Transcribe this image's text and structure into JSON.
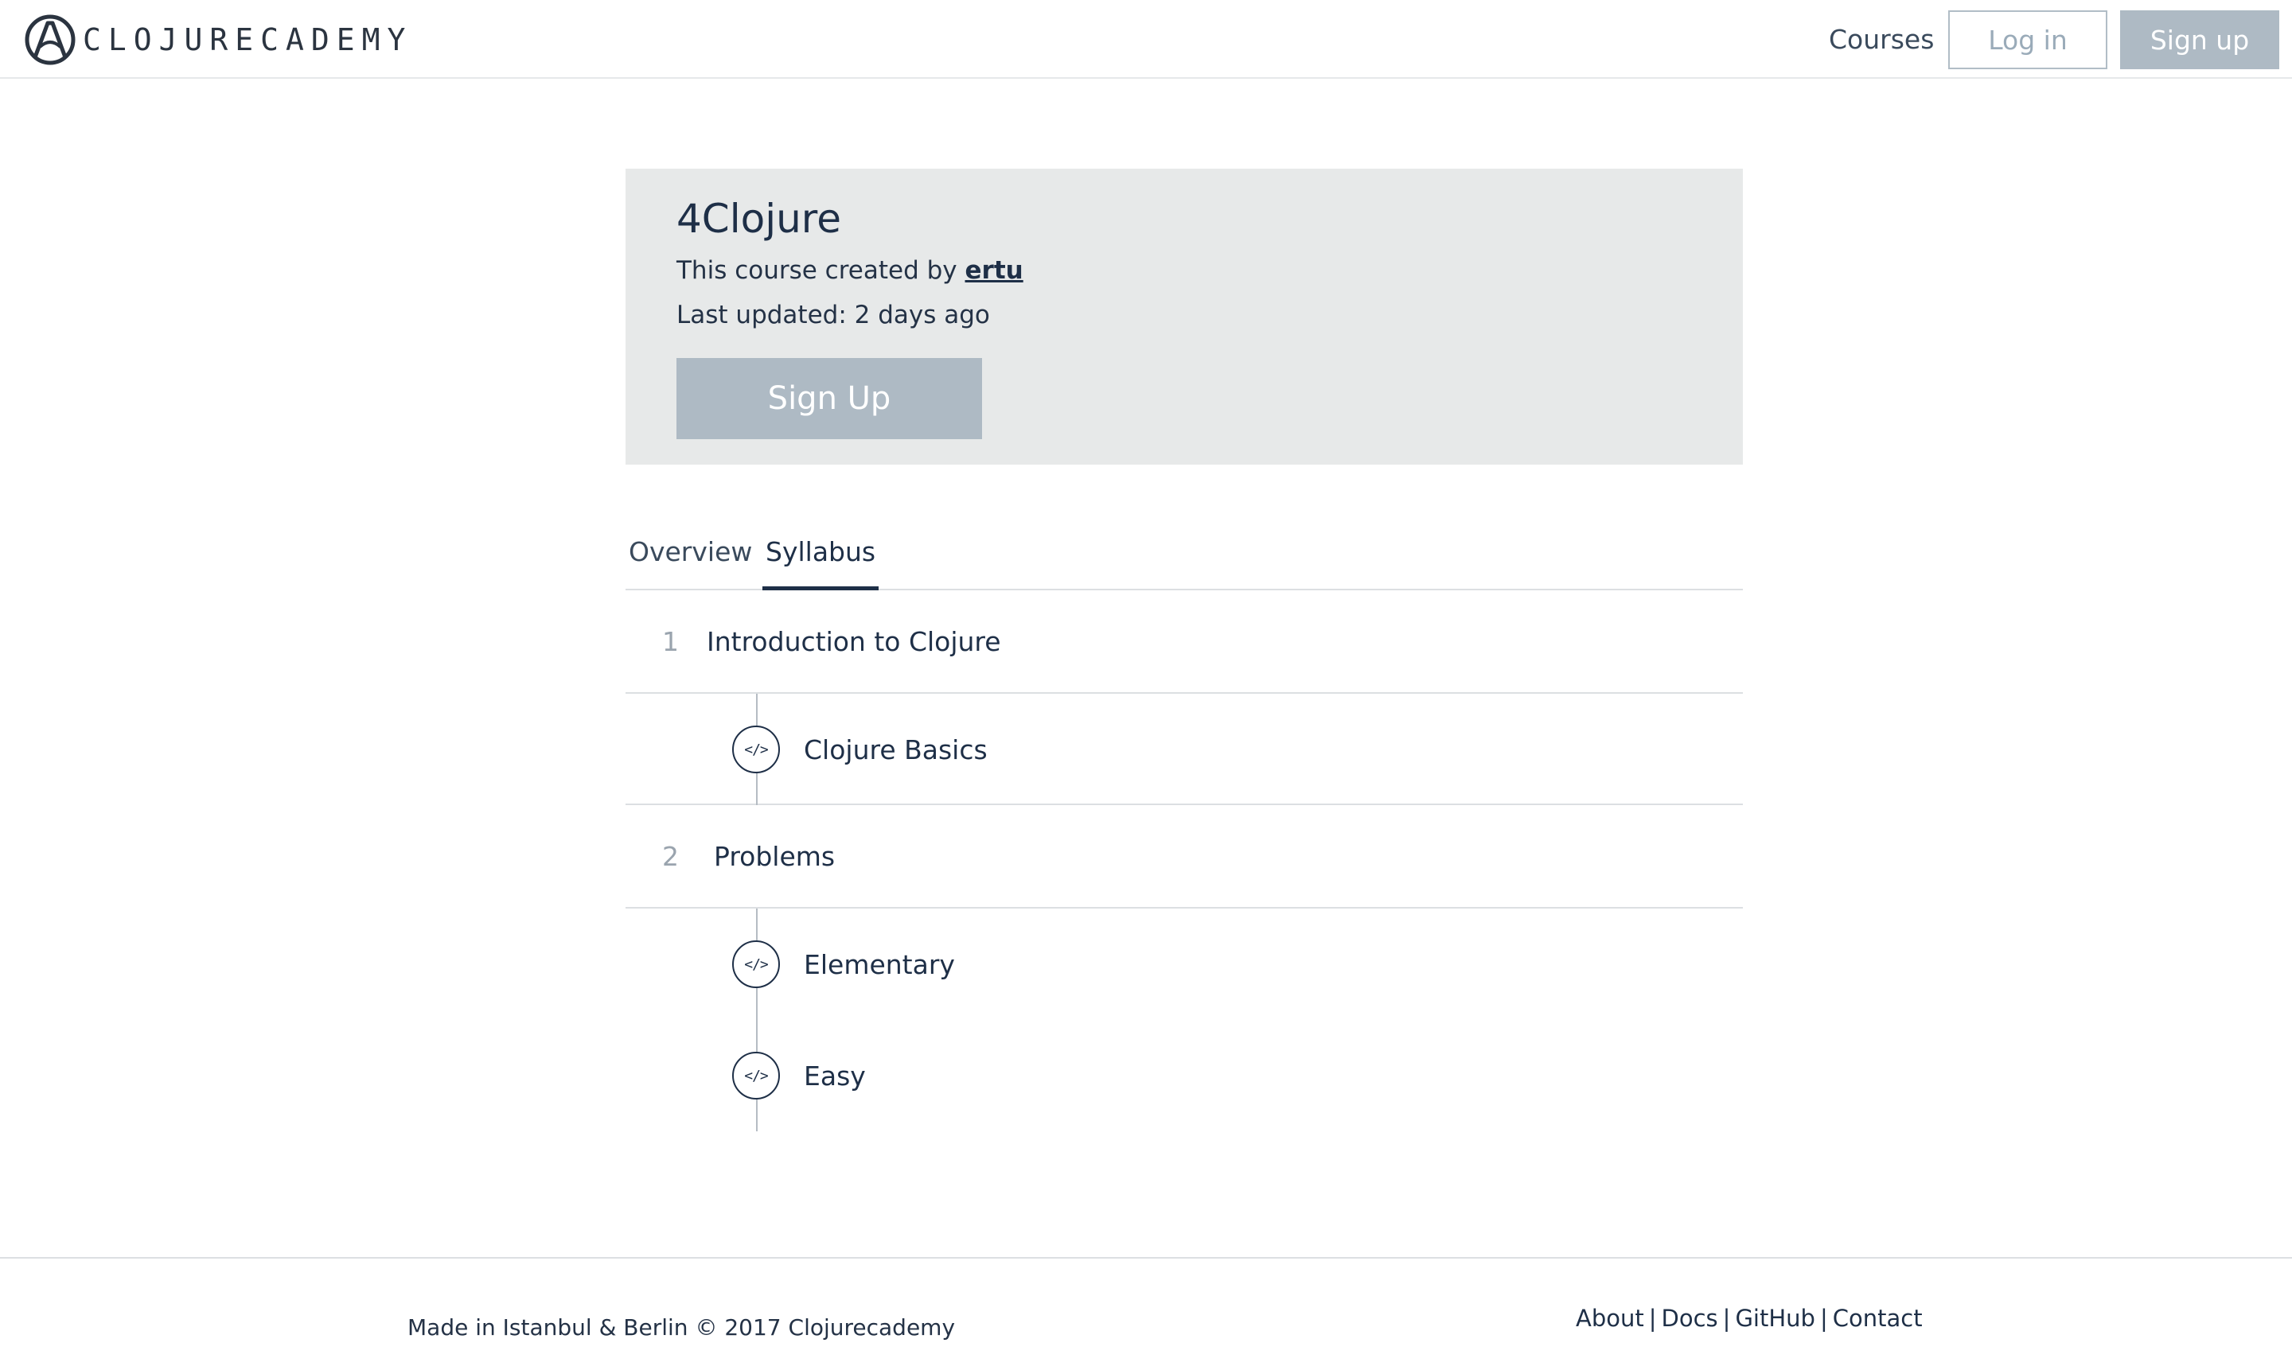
{
  "header": {
    "brand_name": "CLOJURECADEMY",
    "nav_courses": "Courses",
    "login_label": "Log in",
    "signup_label": "Sign up"
  },
  "course": {
    "title": "4Clojure",
    "created_by_prefix": "This course created by",
    "author": "ertu",
    "last_updated": "Last updated: 2 days ago",
    "signup_button": "Sign Up"
  },
  "tabs": [
    {
      "label": "Overview",
      "active": false
    },
    {
      "label": "Syllabus",
      "active": true
    }
  ],
  "syllabus": {
    "sections": [
      {
        "number": "1",
        "title": "Introduction to Clojure",
        "lessons": [
          {
            "icon": "code-icon",
            "glyph": "</>",
            "title": "Clojure Basics"
          }
        ]
      },
      {
        "number": "2",
        "title": "Problems",
        "lessons": [
          {
            "icon": "code-icon",
            "glyph": "</>",
            "title": "Elementary"
          },
          {
            "icon": "code-icon",
            "glyph": "</>",
            "title": "Easy"
          }
        ]
      }
    ]
  },
  "footer": {
    "copyright": "Made in Istanbul & Berlin © 2017 Clojurecademy",
    "links": [
      "About",
      "Docs",
      "GitHub",
      "Contact"
    ],
    "separator": "|"
  },
  "colors": {
    "primary_text": "#1e2f47",
    "button_gray": "#aebac4",
    "card_bg": "#e7e9e9",
    "divider": "#dcdfe2"
  }
}
